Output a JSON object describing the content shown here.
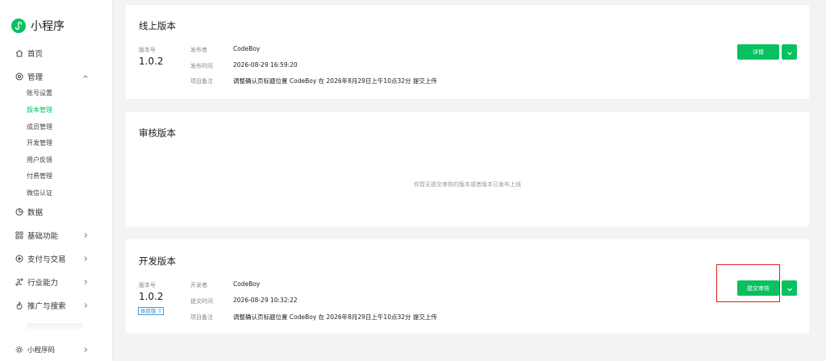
{
  "app": {
    "name": "小程序"
  },
  "nav": {
    "home": "首页",
    "manage": "管理",
    "sub_items": [
      "账号设置",
      "版本管理",
      "成员管理",
      "开发管理",
      "用户反馈",
      "付费管理",
      "微信认证"
    ],
    "data": "数据",
    "basic": "基础功能",
    "pay": "支付与交易",
    "industry": "行业能力",
    "promo": "推广与搜索",
    "qrcode": "小程序码"
  },
  "online": {
    "title": "线上版本",
    "version_label": "版本号",
    "version": "1.0.2",
    "publisher_key": "发布者",
    "publisher": "CodeBoy",
    "time_key": "发布时间",
    "time": "2026-08-29 16:59:20",
    "note_key": "项目备注",
    "note": "调整确认页标题位置 CodeBoy 在 2026年8月29日上午10点32分 提交上传",
    "detail_button": "详情"
  },
  "review": {
    "title": "审核版本",
    "empty": "你暂无提交审核的版本或者版本已发布上线"
  },
  "dev": {
    "title": "开发版本",
    "version_label": "版本号",
    "version": "1.0.2",
    "tag": "体验版 ⠿",
    "developer_key": "开发者",
    "developer": "CodeBoy",
    "time_key": "提交时间",
    "time": "2026-08-29 10:32:22",
    "note_key": "项目备注",
    "note": "调整确认页标题位置 CodeBoy 在 2026年8月29日上午10点32分 提交上传",
    "submit_button": "提交审核"
  },
  "colors": {
    "accent": "#07c160",
    "highlight": "#e0201b"
  }
}
